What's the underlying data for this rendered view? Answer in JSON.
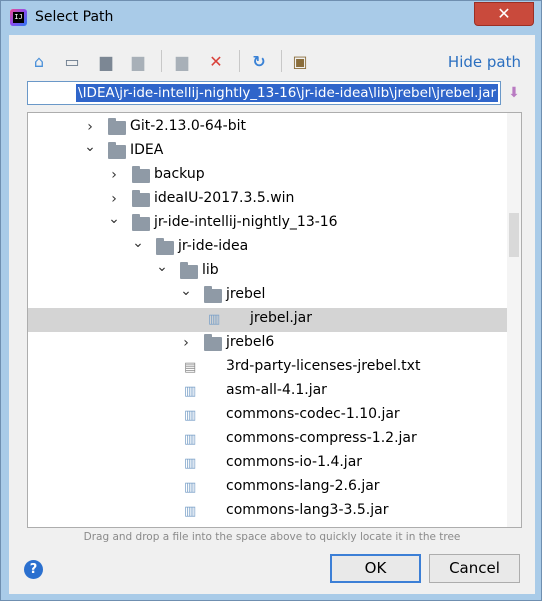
{
  "window": {
    "title": "Select Path",
    "close_glyph": "✕"
  },
  "toolbar": {
    "hide_path_label": "Hide path",
    "buttons": [
      {
        "name": "home-icon",
        "glyph": "⌂"
      },
      {
        "name": "desktop-icon",
        "glyph": "▭"
      },
      {
        "name": "project-folder-icon",
        "glyph": "▆"
      },
      {
        "name": "module-folder-icon",
        "glyph": "▆"
      },
      {
        "name": "new-folder-icon",
        "glyph": "▆"
      },
      {
        "name": "delete-icon",
        "glyph": "✕"
      },
      {
        "name": "refresh-icon",
        "glyph": "↻"
      },
      {
        "name": "show-hidden-icon",
        "glyph": "▣"
      }
    ]
  },
  "path": {
    "value": "\\IDEA\\jr-ide-intellij-nightly_13-16\\jr-ide-idea\\lib\\jrebel\\jrebel.jar"
  },
  "tree": {
    "items": [
      {
        "label": "Git-2.13.0-64-bit",
        "type": "folder",
        "expanded": false,
        "depth": 0
      },
      {
        "label": "IDEA",
        "type": "folder",
        "expanded": true,
        "depth": 0
      },
      {
        "label": "backup",
        "type": "folder",
        "expanded": false,
        "depth": 1
      },
      {
        "label": "ideaIU-2017.3.5.win",
        "type": "folder",
        "expanded": false,
        "depth": 1
      },
      {
        "label": "jr-ide-intellij-nightly_13-16",
        "type": "folder",
        "expanded": true,
        "depth": 1
      },
      {
        "label": "jr-ide-idea",
        "type": "folder",
        "expanded": true,
        "depth": 2
      },
      {
        "label": "lib",
        "type": "folder",
        "expanded": true,
        "depth": 3
      },
      {
        "label": "jrebel",
        "type": "folder",
        "expanded": true,
        "depth": 4
      },
      {
        "label": "jrebel.jar",
        "type": "jar",
        "depth": 5,
        "selected": true
      },
      {
        "label": "jrebel6",
        "type": "folder",
        "expanded": false,
        "depth": 4
      },
      {
        "label": "3rd-party-licenses-jrebel.txt",
        "type": "txt",
        "depth": 4
      },
      {
        "label": "asm-all-4.1.jar",
        "type": "jar",
        "depth": 4
      },
      {
        "label": "commons-codec-1.10.jar",
        "type": "jar",
        "depth": 4
      },
      {
        "label": "commons-compress-1.2.jar",
        "type": "jar",
        "depth": 4
      },
      {
        "label": "commons-io-1.4.jar",
        "type": "jar",
        "depth": 4
      },
      {
        "label": "commons-lang-2.6.jar",
        "type": "jar",
        "depth": 4
      },
      {
        "label": "commons-lang3-3.5.jar",
        "type": "jar",
        "depth": 4
      }
    ]
  },
  "hint": "Drag and drop a file into the space above to quickly locate it in the tree",
  "buttons": {
    "help": "?",
    "ok": "OK",
    "cancel": "Cancel"
  }
}
